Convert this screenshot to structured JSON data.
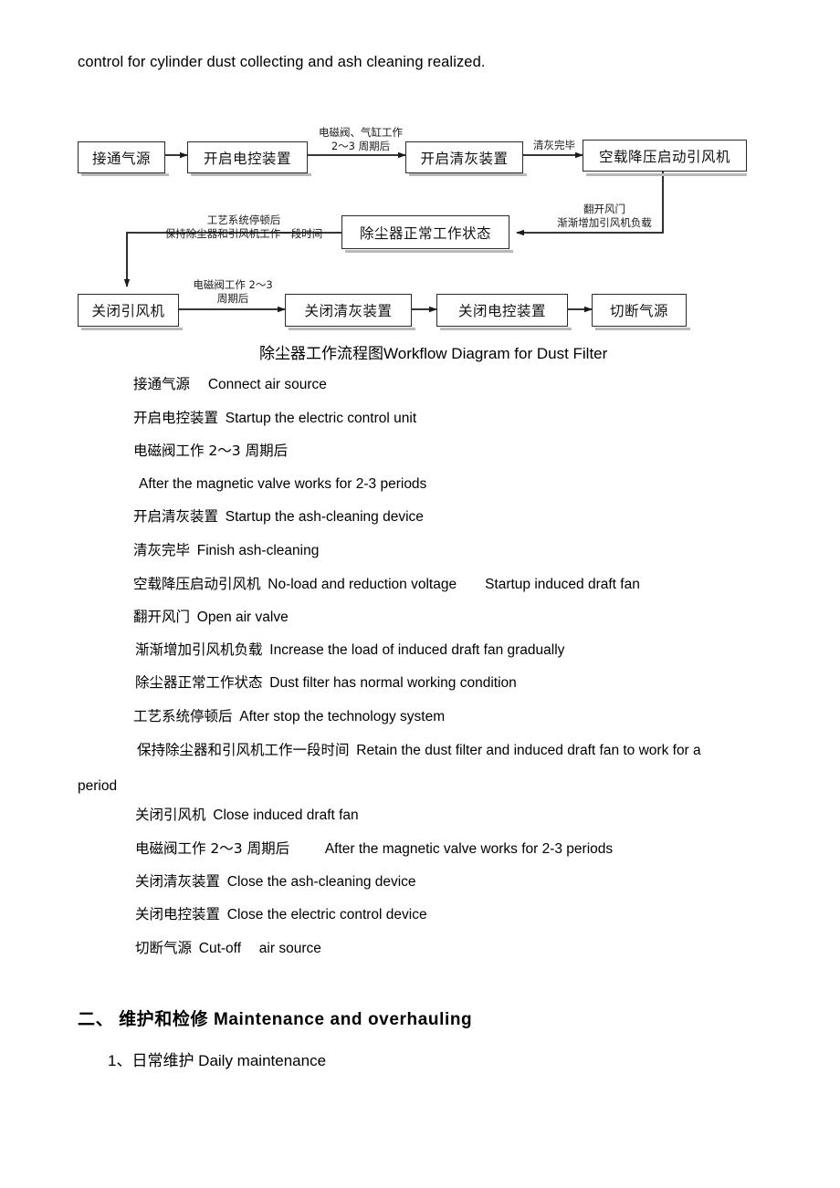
{
  "document": {
    "intro_text": "control for cylinder dust collecting and ash cleaning realized."
  },
  "flowchart": {
    "caption": "除尘器工作流程图Workflow Diagram for Dust Filter",
    "boxes": {
      "connect_air_source": "接通气源",
      "startup_electric_control": "开启电控装置",
      "startup_ash_cleaning": "开启清灰装置",
      "noload_start_fan": "空载降压启动引风机",
      "normal_working_state": "除尘器正常工作状态",
      "close_fan": "关闭引风机",
      "close_ash_cleaning": "关闭清灰装置",
      "close_electric_control": "关闭电控装置",
      "cut_off_air_source": "切断气源"
    },
    "edge_labels": {
      "valve_cylinder_line1": "电磁阀、气缸工作",
      "valve_cylinder_line2": "2～3 周期后",
      "ash_cleaning_finished": "清灰完毕",
      "open_valve_line1": "翻开风门",
      "open_valve_line2": "渐渐增加引风机负载",
      "stop_system_line1": "工艺系统停顿后",
      "stop_system_line2": "保持除尘器和引风机工作一段时间",
      "valve_periods_line1": "电磁阀工作 2～3",
      "valve_periods_line2": "周期后"
    }
  },
  "glossary": [
    {
      "cn": "接通气源",
      "en": "Connect air source",
      "gap": "wide"
    },
    {
      "cn": "开启电控装置",
      "en": "Startup the electric control unit",
      "gap": "normal"
    },
    {
      "cn": "电磁阀工作 2～3 周期后",
      "en": "",
      "gap": "none"
    },
    {
      "cn": "",
      "en": "After the magnetic valve works for 2-3 periods",
      "gap": "none"
    },
    {
      "cn": "开启清灰装置",
      "en": "Startup the ash-cleaning device",
      "gap": "normal"
    },
    {
      "cn": "清灰完毕",
      "en": "Finish ash-cleaning",
      "gap": "normal"
    },
    {
      "cn": "空载降压启动引风机",
      "en": "No-load and reduction voltage　　Startup induced draft fan",
      "gap": "normal"
    },
    {
      "cn": "翻开风门",
      "en": "Open air valve",
      "gap": "normal"
    },
    {
      "cn": "渐渐增加引风机负载",
      "en": "Increase the load of induced draft fan gradually",
      "gap": "normal"
    },
    {
      "cn": "除尘器正常工作状态",
      "en": "Dust filter has normal working condition",
      "gap": "normal"
    },
    {
      "cn": "工艺系统停顿后",
      "en": "After stop the technology system",
      "gap": "normal"
    },
    {
      "cn": "保持除尘器和引风机工作一段时间",
      "en": "Retain the dust filter and induced draft fan to work for a",
      "gap": "normal"
    },
    {
      "cn": "",
      "en": "period",
      "gap": "none"
    },
    {
      "cn": "关闭引风机",
      "en": "Close induced draft fan",
      "gap": "normal"
    },
    {
      "cn": "电磁阀工作 2～3 周期后",
      "en": "　　After the magnetic valve works for 2-3 periods",
      "gap": "normal"
    },
    {
      "cn": "关闭清灰装置",
      "en": "Close the ash-cleaning device",
      "gap": "normal"
    },
    {
      "cn": "关闭电控装置",
      "en": "Close the electric control device",
      "gap": "normal"
    },
    {
      "cn": "切断气源",
      "en": "Cut-off　 air source",
      "gap": "normal"
    }
  ],
  "section": {
    "heading": "二、 维护和检修  Maintenance  and  overhauling",
    "subheading": "1、日常维护  Daily maintenance"
  },
  "colors": {
    "text": "#000000",
    "box_border": "#2b2b2b",
    "box_shadow": "#b9b9b9",
    "connector": "#1a1a1a"
  }
}
